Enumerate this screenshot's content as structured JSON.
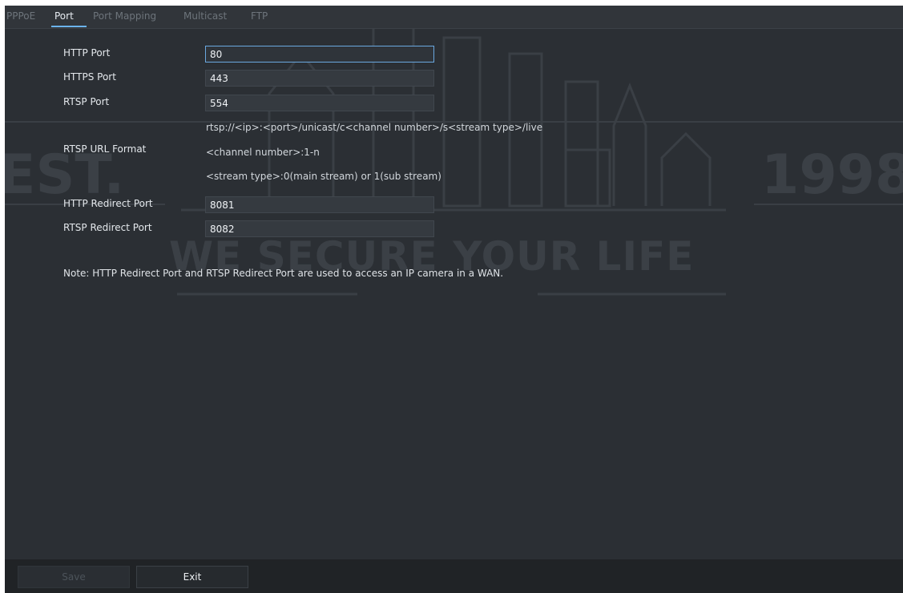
{
  "tabs": [
    {
      "label": "PPPoE"
    },
    {
      "label": "Port"
    },
    {
      "label": "Port Mapping"
    },
    {
      "label": "Multicast"
    },
    {
      "label": "FTP"
    }
  ],
  "active_tab": "Port",
  "form": {
    "http_port": {
      "label": "HTTP Port",
      "value": "80"
    },
    "https_port": {
      "label": "HTTPS Port",
      "value": "443"
    },
    "rtsp_port": {
      "label": "RTSP Port",
      "value": "554"
    },
    "rtsp_url_format": {
      "label": "RTSP URL Format",
      "line1": "rtsp://<ip>:<port>/unicast/c<channel number>/s<stream type>/live",
      "line2": "<channel number>:1-n",
      "line3": "<stream type>:0(main stream) or 1(sub stream)"
    },
    "http_redirect_port": {
      "label": "HTTP Redirect Port",
      "value": "8081"
    },
    "rtsp_redirect_port": {
      "label": "RTSP Redirect Port",
      "value": "8082"
    }
  },
  "note": "Note: HTTP Redirect Port and RTSP Redirect Port are used to access an IP camera in a WAN.",
  "footer": {
    "save_label": "Save",
    "exit_label": "Exit"
  },
  "watermark": {
    "slogan": "WE SECURE YOUR LIFE",
    "est": "EST.",
    "year": "1998"
  },
  "colors": {
    "background": "#2b2f34",
    "accent": "#6bb3ec",
    "text": "#e4e8ec"
  }
}
